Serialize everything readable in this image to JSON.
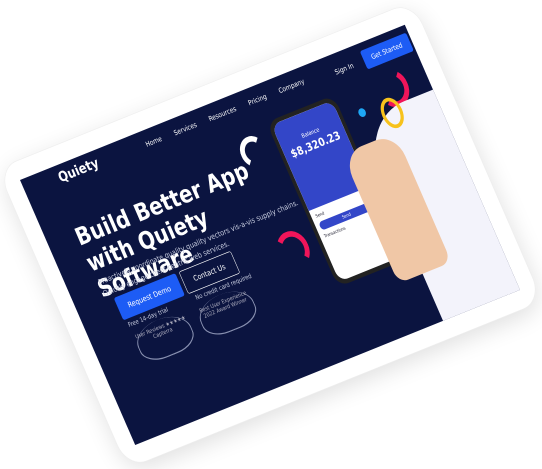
{
  "brand": "Quiety",
  "nav": [
    "Home",
    "Services",
    "Resources",
    "Pricing",
    "Company"
  ],
  "sign_in": "Sign In",
  "get_started": "Get Started",
  "headline": "Build Better App with Quiety Software",
  "subtitle": "Proactively coordinate quality quality vectors vis-a-vis supply chains. Quickly engage client-centric web services.",
  "request_demo": "Request Demo",
  "contact_us": "Contact Us",
  "trial_note": "Free 14-day trial",
  "card_note": "No credit card required",
  "badges": [
    "User Reviews ★★★★★ Capterra",
    "Best User Experience 2022 Award Winner"
  ],
  "phone": {
    "label": "Balance",
    "balance": "$8,320.23",
    "section1": "Send",
    "section2": "Transactions",
    "action": "Send"
  },
  "colors": {
    "background": "#0b1440",
    "accent": "#1d5cf5",
    "pink": "#f0155a",
    "yellow": "#f7c21c"
  }
}
